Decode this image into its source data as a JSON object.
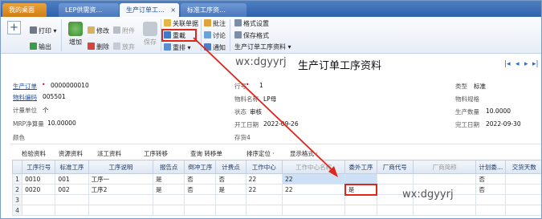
{
  "tabs": [
    {
      "label": "我的桌面"
    },
    {
      "label": "LEP供需资…"
    },
    {
      "label": "生产订单工…",
      "close": "×"
    },
    {
      "label": "标准工序资…"
    }
  ],
  "toolbar": {
    "add_small": "+",
    "print": "打印",
    "export": "输出",
    "add": "增加",
    "modify": "修改",
    "delete": "删除",
    "attach": "附件",
    "abandon": "放弃",
    "save": "保存",
    "related_docs": "关联单据",
    "recalc": "重載",
    "reorder": "重排",
    "approve": "批注",
    "discuss": "讨论",
    "notify": "通知",
    "format_settings": "格式设置",
    "save_format": "保存格式",
    "report_select": "生产订单工序资料"
  },
  "header": {
    "watermark": "wx:dgyyrj",
    "title": "生产订单工序资料"
  },
  "form": {
    "order_label": "生产订单",
    "order_value": "0000000010",
    "material_code_label": "物料编码",
    "material_code_value": "005501",
    "unit_label": "计量单位",
    "unit_value": "个",
    "mrp_label": "MRP净算量",
    "mrp_value": "10.00000",
    "color_label": "颜色",
    "row_label": "行号",
    "row_value": "1",
    "material_name_label": "物料名称",
    "material_name_value": "LP母",
    "status_label": "状态",
    "status_value": "审核",
    "start_label": "开工日期",
    "start_value": "2022-09-26",
    "stock_label": "存货4",
    "type_label": "类型",
    "type_value": "标准",
    "spec_label": "物料规格",
    "qty_label": "生产数量",
    "qty_value": "10.0000",
    "finish_label": "完工日期",
    "finish_value": "2022-09-30"
  },
  "grid_tools": [
    "检验资料",
    "资源资料",
    "派工资料",
    "工序转移",
    "查询 转移单",
    "排序定位 ·",
    "显示格式 ·"
  ],
  "table": {
    "columns": [
      "工序行号",
      "标准工序",
      "工序说明",
      "报告点",
      "倒冲工序",
      "计费点",
      "工作中心",
      "工作中心名称",
      "委外工序",
      "厂商代号",
      "厂商简称",
      "计划委…",
      "交货天数"
    ],
    "rows": [
      {
        "n": "1",
        "cells": [
          "0010",
          "001",
          "工序一",
          "是",
          "否",
          "否",
          "22",
          "22",
          "",
          "",
          "",
          "否",
          ""
        ]
      },
      {
        "n": "2",
        "cells": [
          "0020",
          "002",
          "工序2",
          "是",
          "否",
          "是",
          "22",
          "22",
          "是",
          "",
          "",
          "否",
          ""
        ]
      },
      {
        "n": "3",
        "cells": [
          "",
          "",
          "",
          "",
          "",
          "",
          "",
          "",
          "",
          "",
          "",
          "",
          ""
        ]
      },
      {
        "n": "4",
        "cells": [
          "",
          "",
          "",
          "",
          "",
          "",
          "",
          "",
          "",
          "",
          "",
          "",
          ""
        ]
      }
    ]
  },
  "watermark2": "wx:dgyyrj"
}
